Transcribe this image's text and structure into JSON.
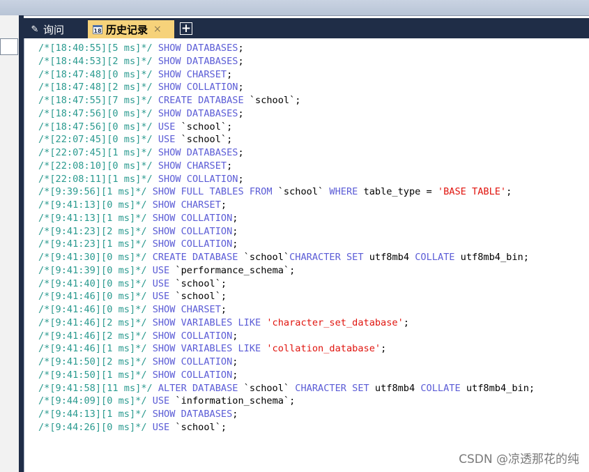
{
  "tabs": {
    "query_label": "询问",
    "history_label": "历史记录",
    "close_symbol": "×",
    "add_symbol": "+"
  },
  "history_lines": [
    [
      [
        "cm",
        "/*[18:40:55][5 ms]*/"
      ],
      [
        "tx",
        " "
      ],
      [
        "kw",
        "SHOW DATABASES"
      ],
      [
        "tx",
        ";"
      ]
    ],
    [
      [
        "cm",
        "/*[18:44:53][2 ms]*/"
      ],
      [
        "tx",
        " "
      ],
      [
        "kw",
        "SHOW DATABASES"
      ],
      [
        "tx",
        ";"
      ]
    ],
    [
      [
        "cm",
        "/*[18:47:48][0 ms]*/"
      ],
      [
        "tx",
        " "
      ],
      [
        "kw",
        "SHOW CHARSET"
      ],
      [
        "tx",
        ";"
      ]
    ],
    [
      [
        "cm",
        "/*[18:47:48][2 ms]*/"
      ],
      [
        "tx",
        " "
      ],
      [
        "kw",
        "SHOW COLLATION"
      ],
      [
        "tx",
        ";"
      ]
    ],
    [
      [
        "cm",
        "/*[18:47:55][7 ms]*/"
      ],
      [
        "tx",
        " "
      ],
      [
        "kw",
        "CREATE DATABASE"
      ],
      [
        "tx",
        " `school`;"
      ]
    ],
    [
      [
        "cm",
        "/*[18:47:56][0 ms]*/"
      ],
      [
        "tx",
        " "
      ],
      [
        "kw",
        "SHOW DATABASES"
      ],
      [
        "tx",
        ";"
      ]
    ],
    [
      [
        "cm",
        "/*[18:47:56][0 ms]*/"
      ],
      [
        "tx",
        " "
      ],
      [
        "kw",
        "USE"
      ],
      [
        "tx",
        " `school`;"
      ]
    ],
    [
      [
        "cm",
        "/*[22:07:45][0 ms]*/"
      ],
      [
        "tx",
        " "
      ],
      [
        "kw",
        "USE"
      ],
      [
        "tx",
        " `school`;"
      ]
    ],
    [
      [
        "cm",
        "/*[22:07:45][1 ms]*/"
      ],
      [
        "tx",
        " "
      ],
      [
        "kw",
        "SHOW DATABASES"
      ],
      [
        "tx",
        ";"
      ]
    ],
    [
      [
        "cm",
        "/*[22:08:10][0 ms]*/"
      ],
      [
        "tx",
        " "
      ],
      [
        "kw",
        "SHOW CHARSET"
      ],
      [
        "tx",
        ";"
      ]
    ],
    [
      [
        "cm",
        "/*[22:08:11][1 ms]*/"
      ],
      [
        "tx",
        " "
      ],
      [
        "kw",
        "SHOW COLLATION"
      ],
      [
        "tx",
        ";"
      ]
    ],
    [
      [
        "cm",
        "/*[9:39:56][1 ms]*/"
      ],
      [
        "tx",
        " "
      ],
      [
        "kw",
        "SHOW FULL TABLES FROM"
      ],
      [
        "tx",
        " `school` "
      ],
      [
        "kw",
        "WHERE"
      ],
      [
        "tx",
        " table_type = "
      ],
      [
        "st",
        "'BASE TABLE'"
      ],
      [
        "tx",
        ";"
      ]
    ],
    [
      [
        "cm",
        "/*[9:41:13][0 ms]*/"
      ],
      [
        "tx",
        " "
      ],
      [
        "kw",
        "SHOW CHARSET"
      ],
      [
        "tx",
        ";"
      ]
    ],
    [
      [
        "cm",
        "/*[9:41:13][1 ms]*/"
      ],
      [
        "tx",
        " "
      ],
      [
        "kw",
        "SHOW COLLATION"
      ],
      [
        "tx",
        ";"
      ]
    ],
    [
      [
        "cm",
        "/*[9:41:23][2 ms]*/"
      ],
      [
        "tx",
        " "
      ],
      [
        "kw",
        "SHOW COLLATION"
      ],
      [
        "tx",
        ";"
      ]
    ],
    [
      [
        "cm",
        "/*[9:41:23][1 ms]*/"
      ],
      [
        "tx",
        " "
      ],
      [
        "kw",
        "SHOW COLLATION"
      ],
      [
        "tx",
        ";"
      ]
    ],
    [
      [
        "cm",
        "/*[9:41:30][0 ms]*/"
      ],
      [
        "tx",
        " "
      ],
      [
        "kw",
        "CREATE DATABASE"
      ],
      [
        "tx",
        " `school`"
      ],
      [
        "kw",
        "CHARACTER SET"
      ],
      [
        "tx",
        " utf8mb4 "
      ],
      [
        "kw",
        "COLLATE"
      ],
      [
        "tx",
        " utf8mb4_bin;"
      ]
    ],
    [
      [
        "cm",
        "/*[9:41:39][0 ms]*/"
      ],
      [
        "tx",
        " "
      ],
      [
        "kw",
        "USE"
      ],
      [
        "tx",
        " `performance_schema`;"
      ]
    ],
    [
      [
        "cm",
        "/*[9:41:40][0 ms]*/"
      ],
      [
        "tx",
        " "
      ],
      [
        "kw",
        "USE"
      ],
      [
        "tx",
        " `school`;"
      ]
    ],
    [
      [
        "cm",
        "/*[9:41:46][0 ms]*/"
      ],
      [
        "tx",
        " "
      ],
      [
        "kw",
        "USE"
      ],
      [
        "tx",
        " `school`;"
      ]
    ],
    [
      [
        "cm",
        "/*[9:41:46][0 ms]*/"
      ],
      [
        "tx",
        " "
      ],
      [
        "kw",
        "SHOW CHARSET"
      ],
      [
        "tx",
        ";"
      ]
    ],
    [
      [
        "cm",
        "/*[9:41:46][2 ms]*/"
      ],
      [
        "tx",
        " "
      ],
      [
        "kw",
        "SHOW VARIABLES LIKE"
      ],
      [
        "tx",
        " "
      ],
      [
        "st",
        "'character_set_database'"
      ],
      [
        "tx",
        ";"
      ]
    ],
    [
      [
        "cm",
        "/*[9:41:46][2 ms]*/"
      ],
      [
        "tx",
        " "
      ],
      [
        "kw",
        "SHOW COLLATION"
      ],
      [
        "tx",
        ";"
      ]
    ],
    [
      [
        "cm",
        "/*[9:41:46][1 ms]*/"
      ],
      [
        "tx",
        " "
      ],
      [
        "kw",
        "SHOW VARIABLES LIKE"
      ],
      [
        "tx",
        " "
      ],
      [
        "st",
        "'collation_database'"
      ],
      [
        "tx",
        ";"
      ]
    ],
    [
      [
        "cm",
        "/*[9:41:50][2 ms]*/"
      ],
      [
        "tx",
        " "
      ],
      [
        "kw",
        "SHOW COLLATION"
      ],
      [
        "tx",
        ";"
      ]
    ],
    [
      [
        "cm",
        "/*[9:41:50][1 ms]*/"
      ],
      [
        "tx",
        " "
      ],
      [
        "kw",
        "SHOW COLLATION"
      ],
      [
        "tx",
        ";"
      ]
    ],
    [
      [
        "cm",
        "/*[9:41:58][11 ms]*/"
      ],
      [
        "tx",
        " "
      ],
      [
        "kw",
        "ALTER DATABASE"
      ],
      [
        "tx",
        " `school` "
      ],
      [
        "kw",
        "CHARACTER SET"
      ],
      [
        "tx",
        " utf8mb4 "
      ],
      [
        "kw",
        "COLLATE"
      ],
      [
        "tx",
        " utf8mb4_bin;"
      ]
    ],
    [
      [
        "cm",
        "/*[9:44:09][0 ms]*/"
      ],
      [
        "tx",
        " "
      ],
      [
        "kw",
        "USE"
      ],
      [
        "tx",
        " `information_schema`;"
      ]
    ],
    [
      [
        "cm",
        "/*[9:44:13][1 ms]*/"
      ],
      [
        "tx",
        " "
      ],
      [
        "kw",
        "SHOW DATABASES"
      ],
      [
        "tx",
        ";"
      ]
    ],
    [
      [
        "cm",
        "/*[9:44:26][0 ms]*/"
      ],
      [
        "tx",
        " "
      ],
      [
        "kw",
        "USE"
      ],
      [
        "tx",
        " `school`;"
      ]
    ]
  ],
  "watermark": "CSDN @凉透那花的纯",
  "colors": {
    "comment": "#2a9a8f",
    "keyword": "#5b5cd6",
    "string": "#e0140e",
    "tab_bar": "#1f2d47",
    "active_tab": "#f6d27a"
  },
  "icons": {
    "query_tab_icon": "query-icon",
    "history_tab_icon": "calendar-icon"
  }
}
